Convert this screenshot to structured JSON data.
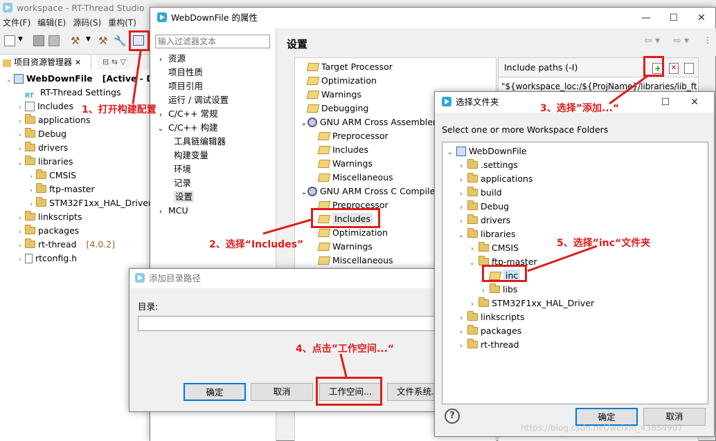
{
  "workspace": {
    "title": "workspace - RT-Thread Studio",
    "menu": [
      "文件(F)",
      "编辑(E)",
      "源码(S)",
      "重构(T)"
    ],
    "explorer_tab": "项目资源管理器",
    "tree": [
      {
        "label": "WebDownFile",
        "suffix": "[Active - D",
        "level": 0,
        "type": "project",
        "expanded": true
      },
      {
        "label": "RT-Thread Settings",
        "level": 1,
        "type": "rt"
      },
      {
        "label": "Includes",
        "level": 1,
        "type": "inc"
      },
      {
        "label": "applications",
        "level": 1,
        "type": "folder"
      },
      {
        "label": "Debug",
        "level": 1,
        "type": "folder"
      },
      {
        "label": "drivers",
        "level": 1,
        "type": "folder"
      },
      {
        "label": "libraries",
        "level": 1,
        "type": "folder",
        "expanded": true
      },
      {
        "label": "CMSIS",
        "level": 2,
        "type": "folder"
      },
      {
        "label": "ftp-master",
        "level": 2,
        "type": "folder"
      },
      {
        "label": "STM32F1xx_HAL_Driver",
        "level": 2,
        "type": "folder"
      },
      {
        "label": "linkscripts",
        "level": 1,
        "type": "folder"
      },
      {
        "label": "packages",
        "level": 1,
        "type": "folder"
      },
      {
        "label": "rt-thread",
        "suffix": "[4.0.2]",
        "level": 1,
        "type": "folder"
      },
      {
        "label": "rtconfig.h",
        "level": 1,
        "type": "file"
      }
    ]
  },
  "props": {
    "title": "WebDownFile 的属性",
    "filter_placeholder": "输入过滤器文本",
    "section_title": "设置",
    "nav": [
      {
        "label": "资源",
        "level": 0,
        "arrow": "›"
      },
      {
        "label": "项目性质",
        "level": 0,
        "arrow": ""
      },
      {
        "label": "项目引用",
        "level": 0,
        "arrow": ""
      },
      {
        "label": "运行 / 调试设置",
        "level": 0,
        "arrow": ""
      },
      {
        "label": "C/C++ 常规",
        "level": 0,
        "arrow": "›"
      },
      {
        "label": "C/C++ 构建",
        "level": 0,
        "arrow": "⌄"
      },
      {
        "label": "工具链编辑器",
        "level": 1,
        "arrow": ""
      },
      {
        "label": "构建变量",
        "level": 1,
        "arrow": ""
      },
      {
        "label": "环境",
        "level": 1,
        "arrow": ""
      },
      {
        "label": "记录",
        "level": 1,
        "arrow": ""
      },
      {
        "label": "设置",
        "level": 1,
        "arrow": "",
        "selected": true
      },
      {
        "label": "MCU",
        "level": 0,
        "arrow": "›"
      }
    ],
    "tools": [
      {
        "label": "Target Processor",
        "level": 0
      },
      {
        "label": "Optimization",
        "level": 0
      },
      {
        "label": "Warnings",
        "level": 0
      },
      {
        "label": "Debugging",
        "level": 0
      },
      {
        "label": "GNU ARM Cross Assembler",
        "level": 0,
        "group": true
      },
      {
        "label": "Preprocessor",
        "level": 1
      },
      {
        "label": "Includes",
        "level": 1
      },
      {
        "label": "Warnings",
        "level": 1
      },
      {
        "label": "Miscellaneous",
        "level": 1
      },
      {
        "label": "GNU ARM Cross C Compiler",
        "level": 0,
        "group": true
      },
      {
        "label": "Preprocessor",
        "level": 1
      },
      {
        "label": "Includes",
        "level": 1,
        "selected": true
      },
      {
        "label": "Optimization",
        "level": 1
      },
      {
        "label": "Warnings",
        "level": 1
      },
      {
        "label": "Miscellaneous",
        "level": 1
      }
    ],
    "include_header": "Include paths (-I)",
    "include_value": "\"${workspace_loc:/${ProjName}/libraries/lib_ftp"
  },
  "adddir": {
    "title": "添加目录路径",
    "label": "目录:",
    "ok": "确定",
    "cancel": "取消",
    "workspace": "工作空间...",
    "filesystem": "文件系统..."
  },
  "folder": {
    "title": "选择文件夹",
    "instruction": "Select one or more Workspace Folders",
    "ok": "确定",
    "cancel": "取消",
    "tree": [
      {
        "label": "WebDownFile",
        "level": 0,
        "arrow": "⌄",
        "type": "project"
      },
      {
        "label": ".settings",
        "level": 1,
        "arrow": "›"
      },
      {
        "label": "applications",
        "level": 1,
        "arrow": "›"
      },
      {
        "label": "build",
        "level": 1,
        "arrow": "›"
      },
      {
        "label": "Debug",
        "level": 1,
        "arrow": "›"
      },
      {
        "label": "drivers",
        "level": 1,
        "arrow": "›"
      },
      {
        "label": "libraries",
        "level": 1,
        "arrow": "⌄"
      },
      {
        "label": "CMSIS",
        "level": 2,
        "arrow": "›"
      },
      {
        "label": "ftp-master",
        "level": 2,
        "arrow": "⌄"
      },
      {
        "label": "inc",
        "level": 3,
        "arrow": "",
        "selected": true,
        "open": true
      },
      {
        "label": "libs",
        "level": 3,
        "arrow": "›"
      },
      {
        "label": "STM32F1xx_HAL_Driver",
        "level": 2,
        "arrow": "›"
      },
      {
        "label": "linkscripts",
        "level": 1,
        "arrow": "›"
      },
      {
        "label": "packages",
        "level": 1,
        "arrow": "›"
      },
      {
        "label": "rt-thread",
        "level": 1,
        "arrow": "›"
      }
    ]
  },
  "annotations": {
    "a1": "1、打开构建配置",
    "a2": "2、选择“Includes”",
    "a3": "3、选择”添加...“",
    "a4": "4、点击”工作空间...“",
    "a5": "5、选择”inc“文件夹"
  },
  "watermark": "https://blog.csdn.net/weixin_43854907"
}
